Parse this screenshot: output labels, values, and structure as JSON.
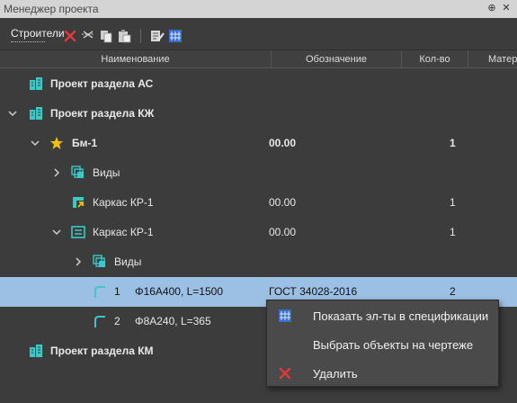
{
  "window": {
    "title": "Менеджер проекта"
  },
  "toolbar": {
    "dropdown_label": "Строители"
  },
  "columns": [
    "Наименование",
    "Обозначение",
    "Кол-во",
    "Матер"
  ],
  "rows": [
    {
      "name": "Проект раздела АС",
      "designation": "",
      "qty": ""
    },
    {
      "name": "Проект раздела КЖ",
      "designation": "",
      "qty": ""
    },
    {
      "name": "Бм-1",
      "designation": "00.00",
      "qty": "1"
    },
    {
      "name": "Виды",
      "designation": "",
      "qty": ""
    },
    {
      "name": "Каркас КР-1",
      "designation": "00.00",
      "qty": "1"
    },
    {
      "name": "Каркас КР-1",
      "designation": "00.00",
      "qty": "1"
    },
    {
      "name": "Виды",
      "designation": "",
      "qty": ""
    },
    {
      "num": "1",
      "name": "Φ16A400, L=1500",
      "designation": "ГОСТ 34028-2016",
      "qty": "2"
    },
    {
      "num": "2",
      "name": "Φ8A240, L=365",
      "designation": "",
      "qty": ""
    },
    {
      "name": "Проект раздела КМ",
      "designation": "",
      "qty": ""
    }
  ],
  "context_menu": {
    "items": [
      {
        "label": "Показать эл-ты в спецификации",
        "icon": "specification-icon"
      },
      {
        "label": "Выбрать объекты на чертеже",
        "icon": ""
      },
      {
        "label": "Удалить",
        "icon": "delete-icon"
      }
    ]
  },
  "colors": {
    "selected_row": "#9cc0e4",
    "accent_teal": "#3ec7c7",
    "star": "#f2c200",
    "delete": "#e23a3a"
  }
}
